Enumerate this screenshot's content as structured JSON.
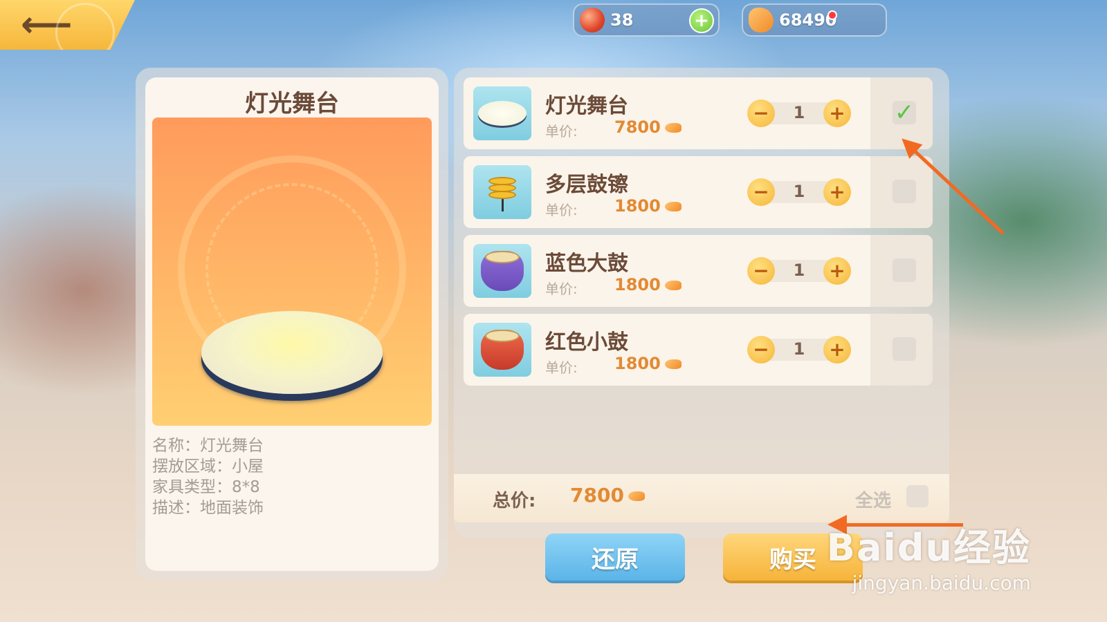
{
  "topbar": {
    "back_icon": "back-arrow-icon",
    "gems": "38",
    "gold": "68490"
  },
  "preview": {
    "title": "灯光舞台",
    "details": [
      "名称：灯光舞台",
      "摆放区域：小屋",
      "家具类型：8*8",
      "描述：地面装饰"
    ]
  },
  "cart": {
    "price_label": "单价:",
    "items": [
      {
        "name": "灯光舞台",
        "price": "7800",
        "qty": "1",
        "checked": true,
        "icon": "light-stage-icon"
      },
      {
        "name": "多层鼓镲",
        "price": "1800",
        "qty": "1",
        "checked": false,
        "icon": "cymbal-icon"
      },
      {
        "name": "蓝色大鼓",
        "price": "1800",
        "qty": "1",
        "checked": false,
        "icon": "blue-drum-icon"
      },
      {
        "name": "红色小鼓",
        "price": "1800",
        "qty": "1",
        "checked": false,
        "icon": "red-drum-icon"
      }
    ],
    "total_label": "总价:",
    "total_value": "7800",
    "select_all": "全选"
  },
  "actions": {
    "reset": "还原",
    "buy": "购买"
  },
  "watermark": {
    "brand": "Baidu经验",
    "url": "jingyan.baidu.com"
  },
  "colors": {
    "accent_orange": "#e28a34",
    "annotation": "#f26a22",
    "check_green": "#5cc43e"
  }
}
